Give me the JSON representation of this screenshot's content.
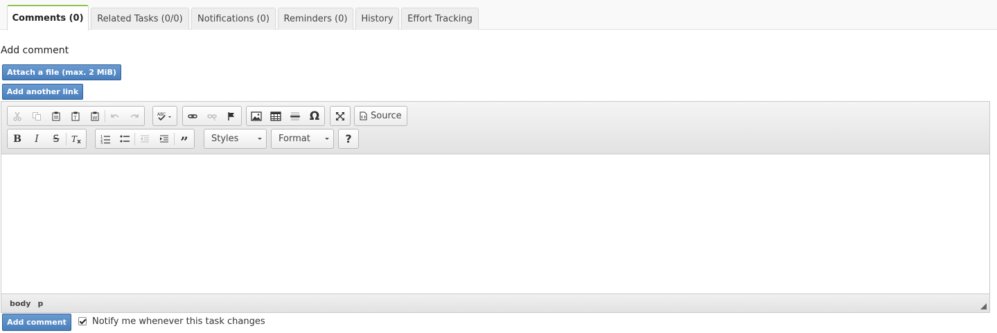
{
  "tabs": [
    {
      "label": "Comments (0)",
      "active": true
    },
    {
      "label": "Related Tasks (0/0)"
    },
    {
      "label": "Notifications (0)"
    },
    {
      "label": "Reminders (0)"
    },
    {
      "label": "History"
    },
    {
      "label": "Effort Tracking"
    }
  ],
  "section": {
    "heading": "Add comment",
    "attach_button": "Attach a file (max. 2 MiB)",
    "add_link_button": "Add another link"
  },
  "editor": {
    "source_label": "Source",
    "styles_label": "Styles",
    "format_label": "Format",
    "help_label": "?",
    "path": [
      "body",
      "p"
    ]
  },
  "footer": {
    "submit_button": "Add comment",
    "notify_label": "Notify me whenever this task changes",
    "notify_checked": true
  },
  "colors": {
    "accent_tab": "#8fc24a",
    "button_blue": "#4a7fbd"
  }
}
